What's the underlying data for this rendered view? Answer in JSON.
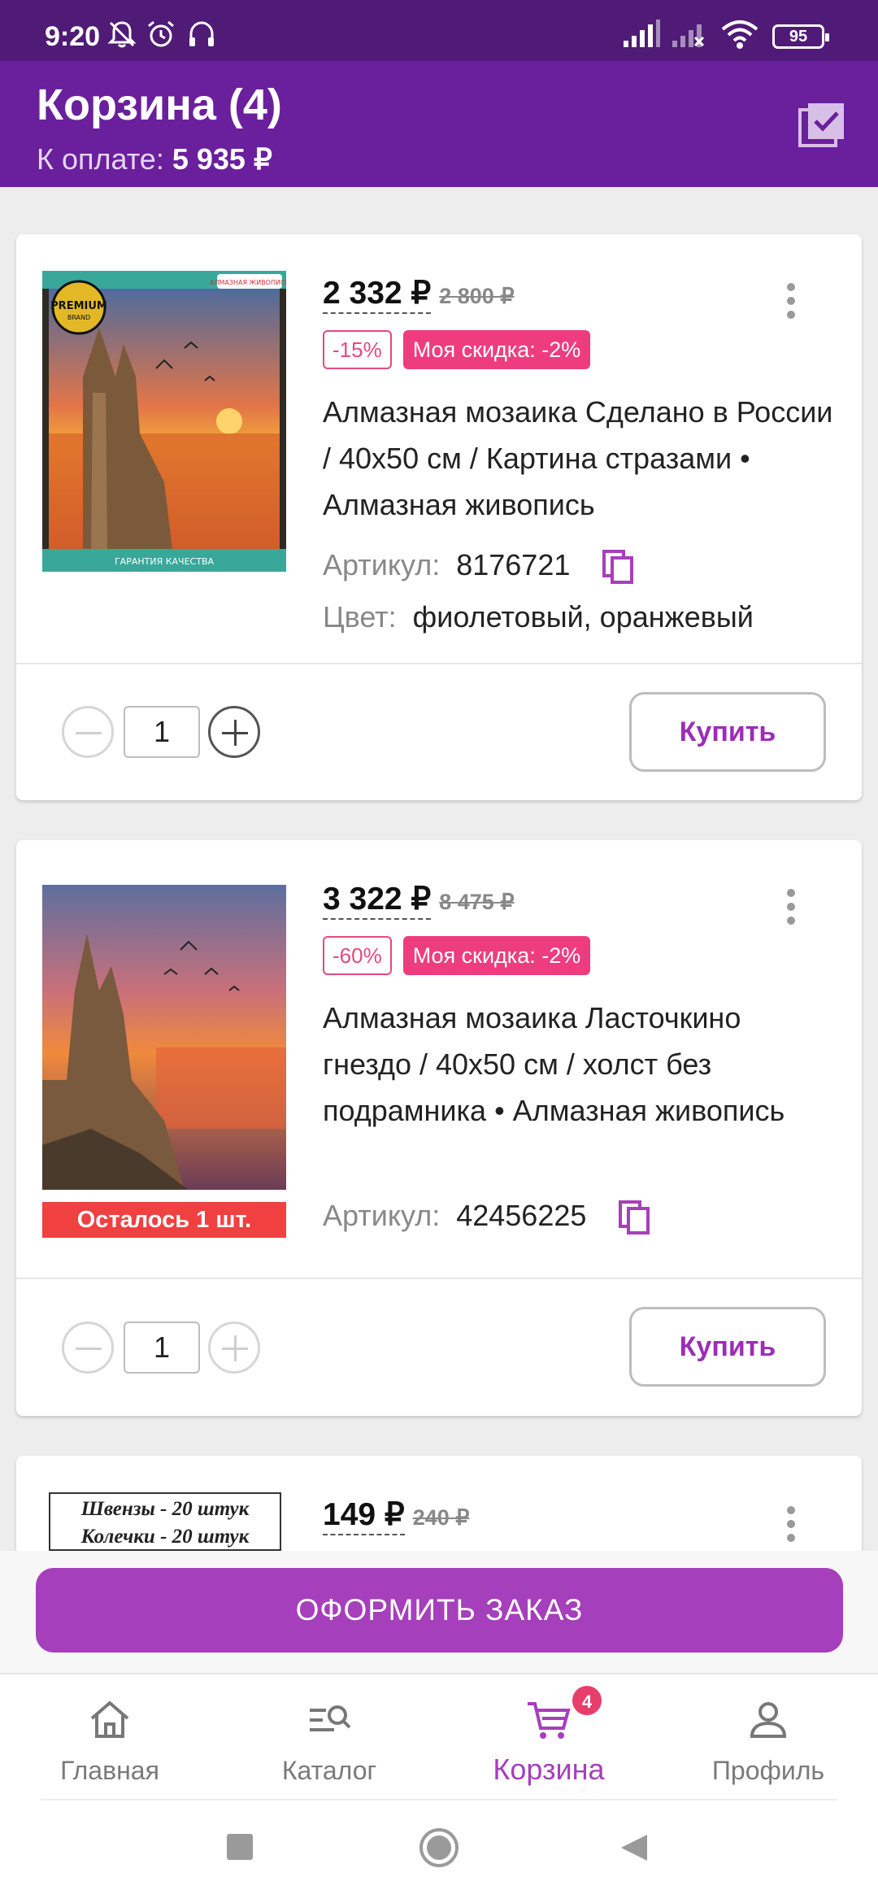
{
  "status_bar": {
    "time": "9:20",
    "battery": "95",
    "icons": [
      "bell-off-icon",
      "alarm-icon",
      "headphones-icon",
      "signal-icon",
      "signal-no-service-icon",
      "wifi-icon",
      "battery-icon"
    ]
  },
  "header": {
    "title": "Корзина (4)",
    "subtitle_label": "К оплате:",
    "subtitle_amount": "5 935 ₽"
  },
  "items": [
    {
      "price": "2 332 ₽",
      "old_price": "2 800 ₽",
      "discount": "-15%",
      "my_discount": "Моя скидка: -2%",
      "name": "Алмазная мозаика Сделано в России / 40x50 см / Картина стразами • Алмазная живопись",
      "article_label": "Артикул:",
      "article": "8176721",
      "color_label": "Цвет:",
      "color": "фиолетовый, оранжевый",
      "quantity": "1",
      "buy_label": "Купить",
      "image_text": {
        "premium": "PREMIUM",
        "brand": "BRAND",
        "logo": "АЛМАЗНАЯ ЖИВОПИСЬ",
        "footer": "ГАРАНТИЯ КАЧЕСТВА"
      }
    },
    {
      "price": "3 322 ₽",
      "old_price": "8 475 ₽",
      "discount": "-60%",
      "my_discount": "Моя скидка: -2%",
      "name": "Алмазная мозаика Ласточкино гнездо / 40x50 см / холст без подрамника • Алмазная живопись",
      "article_label": "Артикул:",
      "article": "42456225",
      "stock": "Осталось 1 шт.",
      "quantity": "1",
      "buy_label": "Купить"
    },
    {
      "price": "149 ₽",
      "old_price": "240 ₽",
      "image_lines": [
        "Швензы - 20 штук",
        "Колечки - 20 штук"
      ]
    }
  ],
  "checkout_label": "ОФОРМИТЬ ЗАКАЗ",
  "bottom_nav": [
    {
      "label": "Главная",
      "icon": "home-icon"
    },
    {
      "label": "Каталог",
      "icon": "catalog-search-icon"
    },
    {
      "label": "Корзина",
      "icon": "cart-icon",
      "badge": "4"
    },
    {
      "label": "Профиль",
      "icon": "profile-icon"
    }
  ],
  "colors": {
    "accent": "#6a1f9c",
    "button": "#a63fbb",
    "badge": "#ee3d7f"
  }
}
